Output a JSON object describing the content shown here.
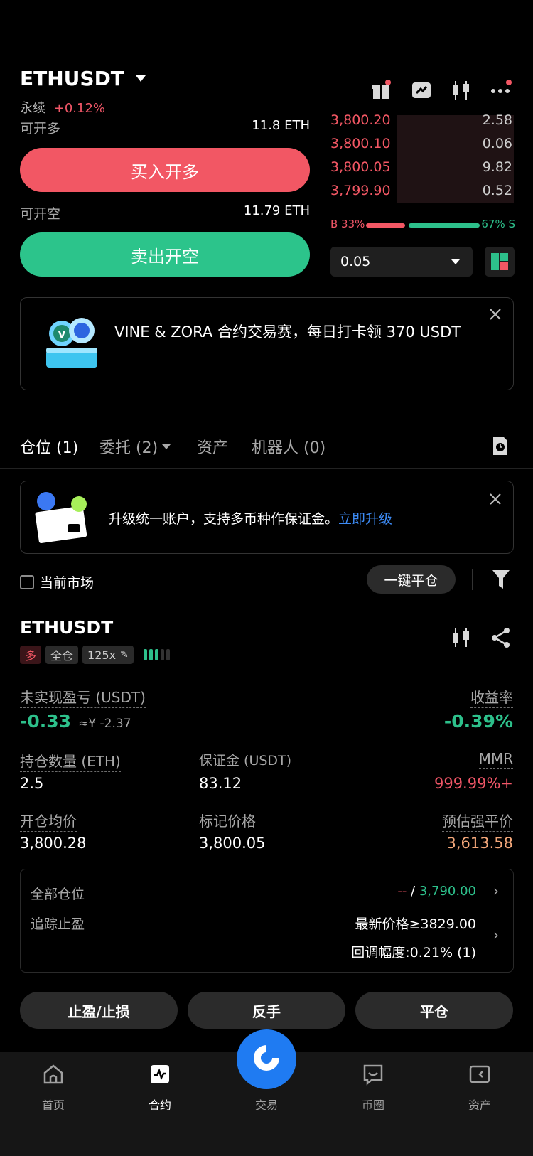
{
  "header": {
    "symbol": "ETHUSDT",
    "contract_type": "永续",
    "change": "+0.12%"
  },
  "trade": {
    "long_available_label": "可开多",
    "long_available_value": "11.8 ETH",
    "long_button": "买入开多",
    "short_available_label": "可开空",
    "short_available_value": "11.79 ETH",
    "short_button": "卖出开空"
  },
  "orderbook": {
    "asks": [
      {
        "price": "3,800.20",
        "qty": "2.58"
      },
      {
        "price": "3,800.10",
        "qty": "0.06"
      },
      {
        "price": "3,800.05",
        "qty": "9.82"
      },
      {
        "price": "3,799.90",
        "qty": "0.52"
      }
    ],
    "buy_ratio": "B 33%",
    "sell_ratio": "67% S",
    "buy_pct": 33,
    "precision": "0.05"
  },
  "banner": {
    "text": "VINE & ZORA 合约交易赛，每日打卡领 370 USDT"
  },
  "tabs": [
    {
      "label": "仓位 (1)"
    },
    {
      "label": "委托 (2)"
    },
    {
      "label": "资产"
    },
    {
      "label": "机器人 (0)"
    }
  ],
  "upgrade": {
    "text": "升级统一账户，支持多币种作保证金。",
    "link": "立即升级"
  },
  "filter": {
    "current_market": "当前市场",
    "close_all": "一键平仓"
  },
  "position": {
    "symbol": "ETHUSDT",
    "side": "多",
    "margin_mode": "全仓",
    "leverage": "125x",
    "unrealized_label": "未实现盈亏 (USDT)",
    "unrealized_value": "-0.33",
    "unrealized_cny": "≈¥ -2.37",
    "roe_label": "收益率",
    "roe_value": "-0.39%",
    "size_label": "持仓数量 (ETH)",
    "size_value": "2.5",
    "margin_label": "保证金 (USDT)",
    "margin_value": "83.12",
    "mmr_label": "MMR",
    "mmr_value": "999.99%+",
    "entry_label": "开仓均价",
    "entry_value": "3,800.28",
    "mark_label": "标记价格",
    "mark_value": "3,800.05",
    "liq_label": "预估强平价",
    "liq_value": "3,613.58"
  },
  "tpsl": {
    "all_label": "全部仓位",
    "tp_value": "--",
    "sl_value": "3,790.00",
    "trailing_label": "追踪止盈",
    "trailing_trigger": "最新价格≥3829.00",
    "trailing_callback": "回调幅度:0.21% (1)"
  },
  "actions": {
    "tpsl": "止盈/止损",
    "reverse": "反手",
    "close": "平仓"
  },
  "nav": [
    {
      "label": "首页"
    },
    {
      "label": "合约"
    },
    {
      "label": "交易"
    },
    {
      "label": "币圈"
    },
    {
      "label": "资产"
    }
  ]
}
